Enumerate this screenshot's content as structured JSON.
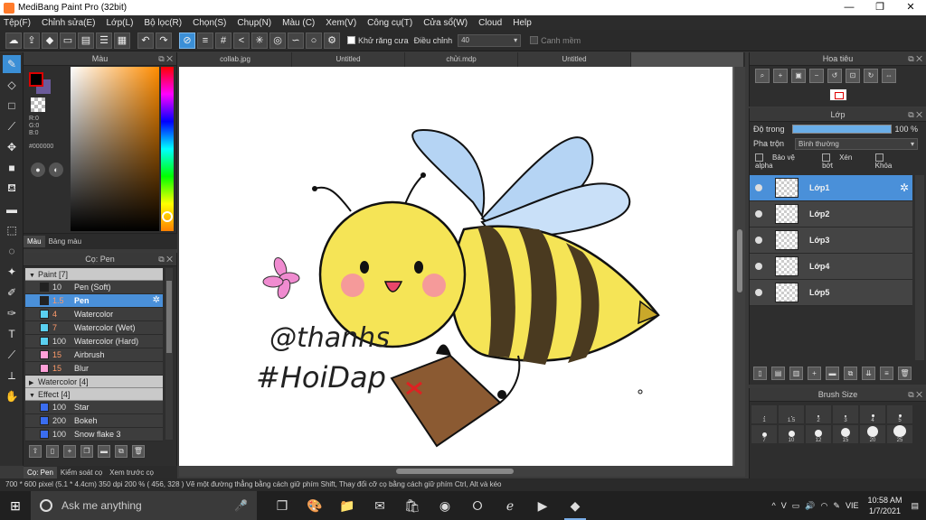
{
  "window": {
    "title": "MediBang Paint Pro (32bit)",
    "controls": [
      "—",
      "❐",
      "✕"
    ]
  },
  "menu": [
    "Tệp(F)",
    "Chỉnh sửa(E)",
    "Lớp(L)",
    "Bộ lọc(R)",
    "Chọn(S)",
    "Chụp(N)",
    "Màu (C)",
    "Xem(V)",
    "Công cụ(T)",
    "Cửa sổ(W)",
    "Cloud",
    "Help"
  ],
  "toolbar": {
    "antialias_label": "Khử răng cưa",
    "adjust_label": "Điều chỉnh",
    "adjust_value": "40",
    "soft_edge_label": "Canh mềm"
  },
  "color_panel": {
    "title": "Màu",
    "r": "R:0",
    "g": "G:0",
    "b": "B:0",
    "hex": "#000000",
    "tab_color": "Màu",
    "tab_palette": "Bảng màu",
    "fg_color": "#000000",
    "bg_color": "#6b5b9a"
  },
  "brush_panel": {
    "title": "Cọ: Pen",
    "groups": [
      {
        "name": "Paint [7]",
        "open": true,
        "items": [
          {
            "size": "10",
            "name": "Pen (Soft)",
            "color": "#222222"
          },
          {
            "size": "1.5",
            "name": "Pen",
            "color": "#222222",
            "selected": true
          },
          {
            "size": "4",
            "name": "Watercolor",
            "color": "#5ad0f0"
          },
          {
            "size": "7",
            "name": "Watercolor (Wet)",
            "color": "#5ad0f0"
          },
          {
            "size": "100",
            "name": "Watercolor (Hard)",
            "color": "#5ad0f0"
          },
          {
            "size": "15",
            "name": "Airbrush",
            "color": "#ff9fd8"
          },
          {
            "size": "15",
            "name": "Blur",
            "color": "#ff9fd8"
          }
        ]
      },
      {
        "name": "Watercolor [4]",
        "open": false,
        "items": []
      },
      {
        "name": "Effect [4]",
        "open": true,
        "items": [
          {
            "size": "100",
            "name": "Star",
            "color": "#3a6df0"
          },
          {
            "size": "200",
            "name": "Bokeh",
            "color": "#3a6df0"
          },
          {
            "size": "100",
            "name": "Snow flake 3",
            "color": "#3a6df0"
          }
        ]
      }
    ]
  },
  "left_tabs": [
    "Cọ: Pen",
    "Kiểm soát cọ",
    "Xem trước cọ"
  ],
  "doc_tabs": [
    "collab.jpg",
    "Untitled",
    "chửi.mdp",
    "Untitled"
  ],
  "canvas_text": {
    "line1": "@thanhs",
    "line2": "#HoiDap"
  },
  "navigator": {
    "title": "Hoa tiêu"
  },
  "layer_panel": {
    "title": "Lớp",
    "opacity_label": "Độ trong",
    "opacity_value": "100 %",
    "opacity_fraction": 1.0,
    "blend_label": "Pha trộn",
    "blend_value": "Bình thường",
    "protect_alpha": "Bảo vệ alpha",
    "clipping": "Xén bớt",
    "lock": "Khóa",
    "layers": [
      {
        "name": "Lớp1",
        "selected": true
      },
      {
        "name": "Lớp2"
      },
      {
        "name": "Lớp3"
      },
      {
        "name": "Lớp4"
      },
      {
        "name": "Lớp5"
      }
    ]
  },
  "brush_size": {
    "title": "Brush Size",
    "sizes": [
      "1",
      "1.5",
      "2",
      "3",
      "4",
      "5",
      "7",
      "10",
      "12",
      "15",
      "20",
      "25"
    ]
  },
  "status": {
    "text": "700 * 600 pixel   (5.1 * 4.4cm)   350 dpi   200 %   ( 456, 328 )   Vẽ một đường thẳng bằng cách giữ phím Shift, Thay đổi cỡ cọ bằng cách giữ phím Ctrl, Alt và kéo"
  },
  "taskbar": {
    "search_placeholder": "Ask me anything",
    "lang": "VIE",
    "time": "10:58 AM",
    "date": "1/7/2021"
  }
}
